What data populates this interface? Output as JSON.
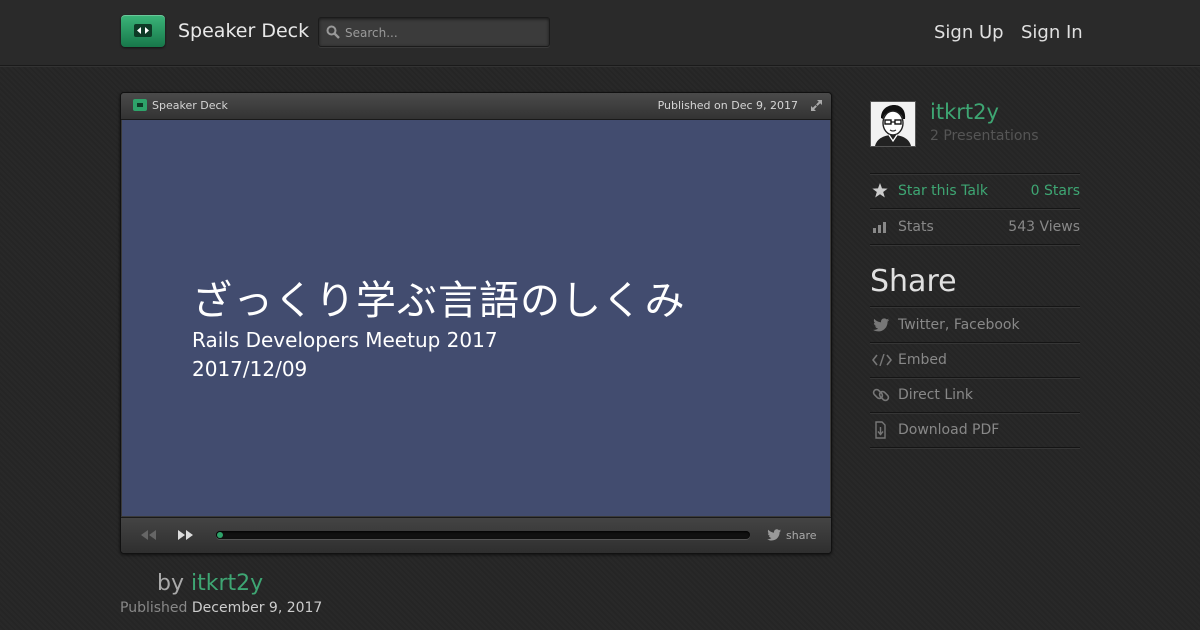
{
  "header": {
    "brand": "Speaker Deck",
    "search_placeholder": "Search...",
    "sign_up": "Sign Up",
    "sign_in": "Sign In"
  },
  "player": {
    "brand": "Speaker Deck",
    "published": "Published on Dec 9, 2017",
    "share_label": "share",
    "progress_fraction": 0.01,
    "slide": {
      "title": "ざっくり学ぶ言語のしくみ",
      "subtitle": "Rails Developers Meetup 2017",
      "date": "2017/12/09"
    }
  },
  "byline": {
    "by": "by",
    "author": "itkrt2y",
    "published_label": "Published",
    "published_date": "December 9, 2017"
  },
  "sidebar": {
    "username": "itkrt2y",
    "presentations": "2 Presentations",
    "star_label": "Star this Talk",
    "star_count": "0 Stars",
    "stats_label": "Stats",
    "views": "543 Views",
    "share_title": "Share",
    "share_items": [
      {
        "label": "Twitter, Facebook",
        "icon": "twitter-icon"
      },
      {
        "label": "Embed",
        "icon": "code-icon"
      },
      {
        "label": "Direct Link",
        "icon": "link-icon"
      },
      {
        "label": "Download PDF",
        "icon": "download-icon"
      }
    ]
  },
  "colors": {
    "accent": "#3ea673",
    "slide_bg": "#424c6f",
    "page_bg": "#262626"
  }
}
